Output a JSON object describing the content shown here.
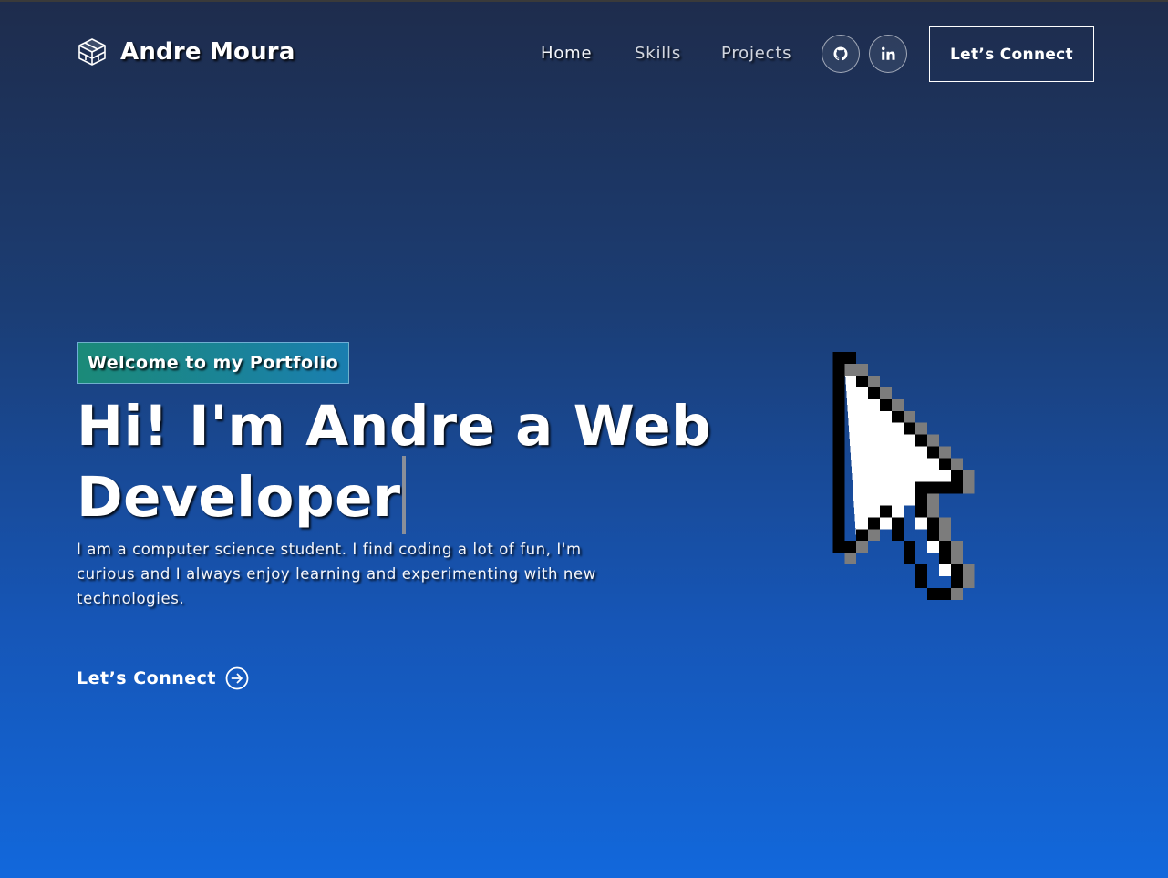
{
  "nav": {
    "brand": "Andre Moura",
    "links": [
      "Home",
      "Skills",
      "Projects"
    ],
    "social": [
      {
        "icon": "github-icon"
      },
      {
        "icon": "linkedin-icon"
      }
    ],
    "connect_label": "Let’s Connect"
  },
  "hero": {
    "tagline": "Welcome to my Portfolio",
    "title_line1": "Hi! I'm Andre a Web",
    "title_line2": "Developer",
    "description": "I am a computer science student. I find coding a lot of fun, I'm curious and I always enjoy learning and experimenting with new technologies.",
    "cta_label": "Let’s Connect"
  },
  "colors": {
    "background_top": "#1e2c4c",
    "background_bottom": "#1268dc",
    "tagline_start": "#1b8a78",
    "tagline_end": "#1a7eb0"
  }
}
